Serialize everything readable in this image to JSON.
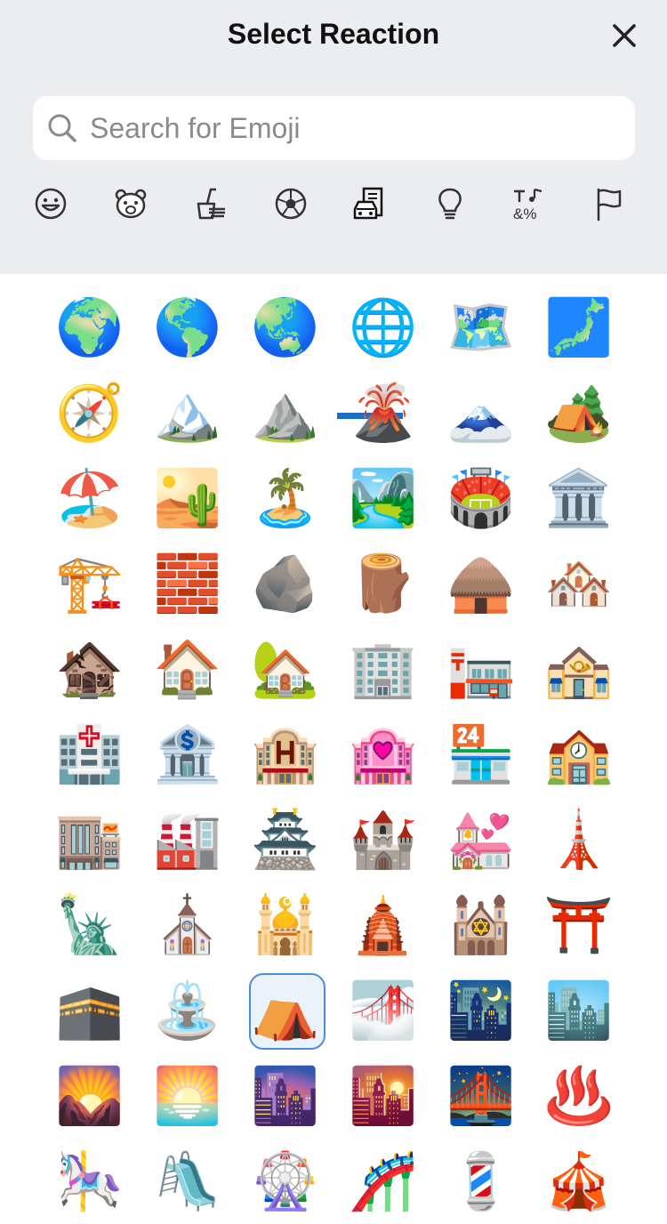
{
  "header": {
    "title": "Select Reaction"
  },
  "search": {
    "placeholder": "Search for Emoji",
    "value": ""
  },
  "tabs": [
    {
      "icon": "smiley-face-icon"
    },
    {
      "icon": "bear-face-icon"
    },
    {
      "icon": "food-drink-icon"
    },
    {
      "icon": "soccer-ball-icon"
    },
    {
      "icon": "travel-places-icon",
      "selected": true
    },
    {
      "icon": "lightbulb-icon"
    },
    {
      "icon": "symbols-icon"
    },
    {
      "icon": "flag-icon"
    }
  ],
  "accent_color": "#1b6ec2",
  "emoji_grid": [
    "🌍",
    "🌎",
    "🌏",
    "🌐",
    "🗺️",
    "🗾",
    "🧭",
    "🏔️",
    "⛰️",
    "🌋",
    "🗻",
    "🏕️",
    "🏖️",
    "🏜️",
    "🏝️",
    "🏞️",
    "🏟️",
    "🏛️",
    "🏗️",
    "🧱",
    "🪨",
    "🪵",
    "🛖",
    "🏘️",
    "🏚️",
    "🏠",
    "🏡",
    "🏢",
    "🏣",
    "🏤",
    "🏥",
    "🏦",
    "🏨",
    "🏩",
    "🏪",
    "🏫",
    "🏬",
    "🏭",
    "🏯",
    "🏰",
    "💒",
    "🗼",
    "🗽",
    "⛪",
    "🕌",
    "🛕",
    "🕍",
    "⛩️",
    "🕋",
    "⛲",
    "⛺",
    "🌁",
    "🌃",
    "🏙️",
    "🌄",
    "🌅",
    "🌆",
    "🌇",
    "🌉",
    "♨️",
    "🎠",
    "🛝",
    "🎡",
    "🎢",
    "💈",
    "🎪"
  ],
  "selected_emoji": "⛺"
}
